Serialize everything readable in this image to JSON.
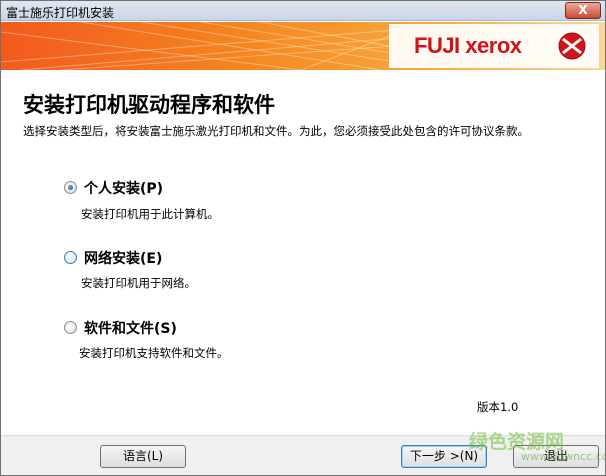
{
  "window": {
    "title": "富士施乐打印机安装",
    "close_label": "X"
  },
  "banner": {
    "logo_text": "FUJI xerox"
  },
  "content": {
    "heading": "安装打印机驱动程序和软件",
    "subtext": "选择安装类型后，将安装富士施乐激光打印机和文件。为此，您必须接受此处包含的许可协议条款。",
    "options": [
      {
        "label": "个人安装(P)",
        "description": "安装打印机用于此计算机。",
        "selected": true
      },
      {
        "label": "网络安装(E)",
        "description": "安装打印机用于网络。",
        "selected": false
      },
      {
        "label": "软件和文件(S)",
        "description": "安装打印机支持软件和文件。",
        "selected": false
      }
    ],
    "version": "版本1.0"
  },
  "footer": {
    "language_button": "语言(L)",
    "next_button": "下一步 >(N)",
    "exit_button": "退出"
  },
  "watermark": {
    "text": "绿色资源网",
    "url": "www.downcc.com"
  },
  "colors": {
    "brand_red": "#d0121b",
    "banner_orange": "#f15a1f",
    "radio_selected": "#164f9a"
  }
}
